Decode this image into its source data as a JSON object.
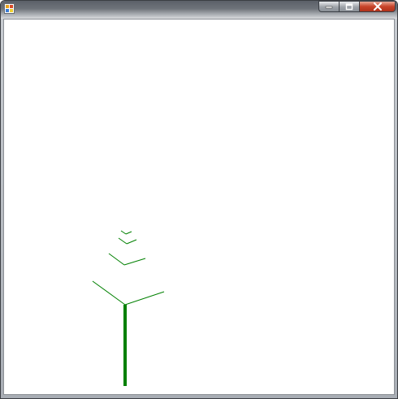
{
  "window": {
    "title": "",
    "app_icon": "windows-forms-app-icon",
    "buttons": {
      "minimize": {
        "icon": "minimize-icon",
        "glyph": "—"
      },
      "maximize": {
        "icon": "maximize-icon",
        "glyph": "□"
      },
      "close": {
        "icon": "close-icon",
        "glyph": "✕"
      }
    }
  },
  "drawing": {
    "subject": "tree-fractal",
    "color": "#008000"
  }
}
